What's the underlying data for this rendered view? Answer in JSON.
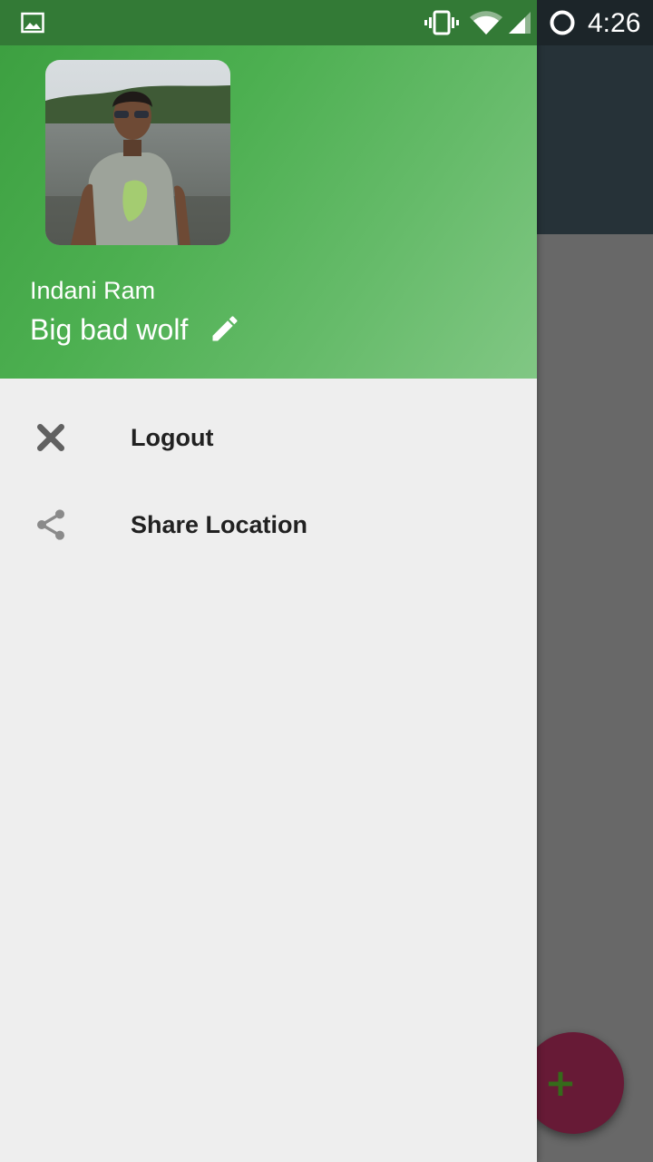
{
  "status_bar": {
    "time": "4:26",
    "icons": [
      "image-notification-icon",
      "vibrate-icon",
      "wifi-icon",
      "cell-signal-icon",
      "loading-circle-icon"
    ]
  },
  "drawer": {
    "profile": {
      "name": "Indani Ram",
      "status": "Big bad wolf"
    },
    "menu": [
      {
        "label": "Logout",
        "icon": "close-icon"
      },
      {
        "label": "Share Location",
        "icon": "share-icon"
      }
    ]
  },
  "fab": {
    "label": "+",
    "icon": "add-icon"
  },
  "colors": {
    "drawer_header_start": "#3b9e3f",
    "drawer_header_end": "#81c784",
    "drawer_background": "#eeeeee",
    "status_bar_left": "#337a36",
    "app_toolbar": "#263238",
    "app_scrim": "#686868",
    "fab": "#671a36"
  }
}
